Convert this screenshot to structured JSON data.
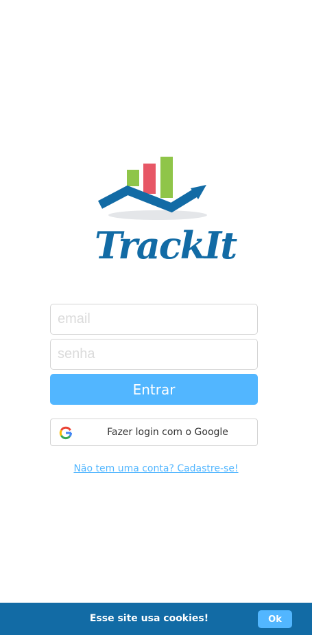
{
  "brand": {
    "name": "TrackIt",
    "colors": {
      "primary": "#126ba5",
      "accent": "#52b6ff",
      "bar_green": "#8fc549",
      "bar_red": "#e75766"
    }
  },
  "login_form": {
    "email_placeholder": "email",
    "email_value": "",
    "password_placeholder": "senha",
    "password_value": "",
    "submit_label": "Entrar"
  },
  "google_login": {
    "icon": "google-g-icon",
    "label": "Fazer login com o Google"
  },
  "signup": {
    "link_text": "Não tem uma conta? Cadastre-se!"
  },
  "cookie_banner": {
    "message": "Esse site usa cookies!",
    "ok_label": "Ok"
  }
}
